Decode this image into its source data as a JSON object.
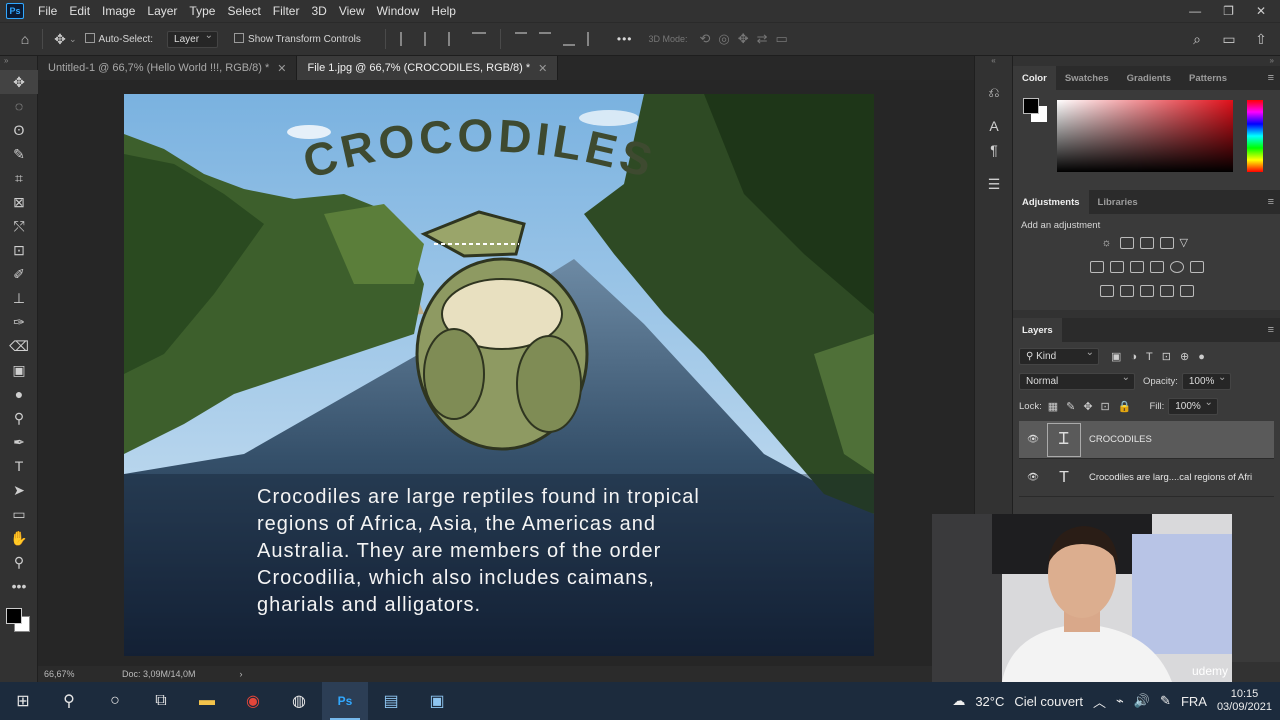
{
  "app": {
    "logo": "Ps"
  },
  "menu": [
    "File",
    "Edit",
    "Image",
    "Layer",
    "Type",
    "Select",
    "Filter",
    "3D",
    "View",
    "Window",
    "Help"
  ],
  "window_controls": [
    "—",
    "❐",
    "✕"
  ],
  "options": {
    "auto_select_label": "Auto-Select:",
    "auto_select_target": "Layer",
    "show_transform_label": "Show Transform Controls",
    "mode_3d": "3D Mode:",
    "more": "•••"
  },
  "tabs": [
    {
      "label": "Untitled-1 @ 66,7% (Hello World !!!, RGB/8) *",
      "close": "✕"
    },
    {
      "label": "File 1.jpg @ 66,7% (CROCODILES, RGB/8) *",
      "close": "✕"
    }
  ],
  "document": {
    "title_text": "CROCODILES",
    "body_lines": [
      "Crocodiles are large reptiles found in tropical",
      "regions of Africa, Asia, the Americas and",
      "Australia. They are members of the order",
      "Crocodilia, which also includes caimans,",
      "gharials and alligators."
    ],
    "title_color": "#3e4a30",
    "body_color": "#f4f4f4"
  },
  "statusbar": {
    "zoom": "66,67%",
    "doc_info": "Doc: 3,09M/14,0M",
    "arrow": "›"
  },
  "panels": {
    "color_tabs": [
      "Color",
      "Swatches",
      "Gradients",
      "Patterns"
    ],
    "adjust_tabs": [
      "Adjustments",
      "Libraries"
    ],
    "add_adjustment": "Add an adjustment",
    "layers_tab": "Layers",
    "kind_filter": "Kind",
    "blend_mode": "Normal",
    "opacity_label": "Opacity:",
    "opacity_value": "100%",
    "lock_label": "Lock:",
    "fill_label": "Fill:",
    "fill_value": "100%",
    "layers": [
      {
        "name": "CROCODILES",
        "type": "warped-text"
      },
      {
        "name": "Crocodiles are larg....cal regions of Afri",
        "type": "text"
      }
    ]
  },
  "taskbar": {
    "weather_temp": "32°C",
    "weather_desc": "Ciel couvert",
    "lang": "FRA",
    "time": "10:15",
    "date": "03/09/2021",
    "watermark": "udemy"
  },
  "colors": {
    "accent": "#31a8ff",
    "fg_swatch": "#000000",
    "bg_swatch": "#ffffff"
  }
}
